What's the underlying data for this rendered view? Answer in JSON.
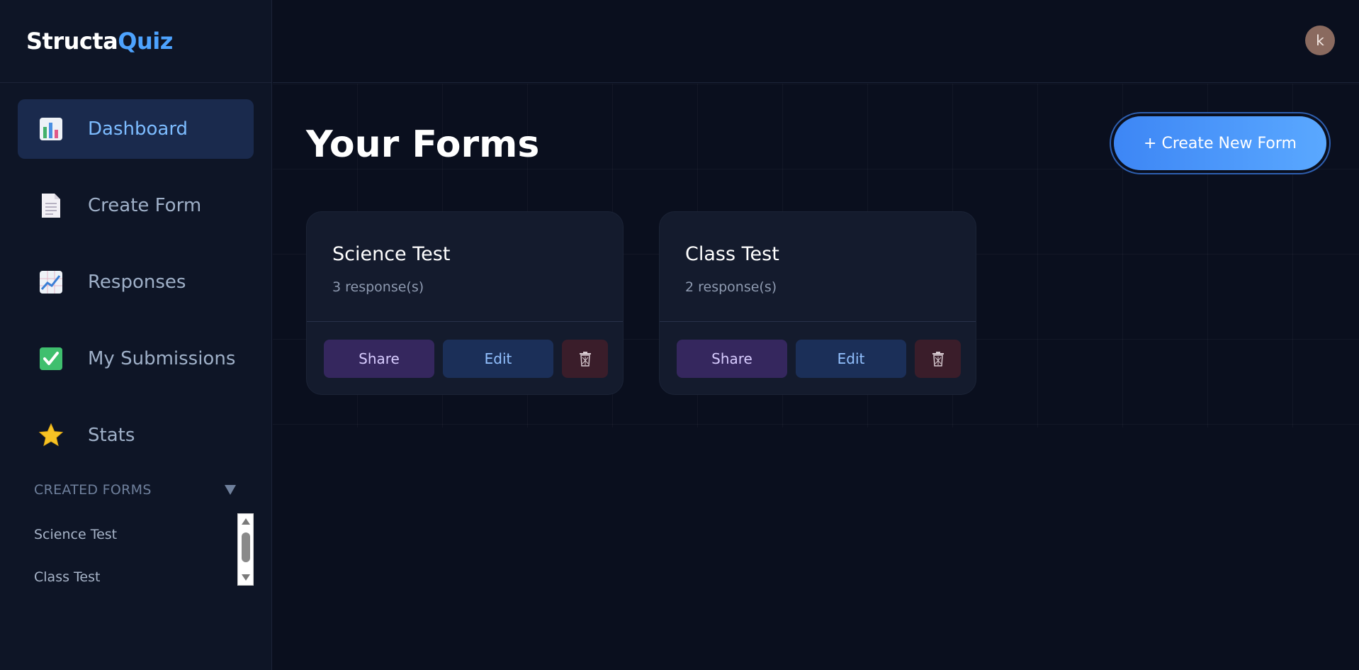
{
  "brand": {
    "part1": "Structa",
    "part2": "Quiz"
  },
  "nav": [
    {
      "label": "Dashboard",
      "icon": "bar-chart-icon",
      "active": true
    },
    {
      "label": "Create Form",
      "icon": "document-icon",
      "active": false
    },
    {
      "label": "Responses",
      "icon": "line-chart-icon",
      "active": false
    },
    {
      "label": "My Submissions",
      "icon": "checkbox-icon",
      "active": false
    },
    {
      "label": "Stats",
      "icon": "star-icon",
      "active": false
    }
  ],
  "created_forms": {
    "heading": "CREATED FORMS",
    "items": [
      "Science Test",
      "Class Test"
    ]
  },
  "user": {
    "avatar_letter": "k"
  },
  "main": {
    "title": "Your Forms",
    "create_button": "+ Create New Form",
    "forms": [
      {
        "title": "Science Test",
        "responses": "3 response(s)",
        "share": "Share",
        "edit": "Edit"
      },
      {
        "title": "Class Test",
        "responses": "2 response(s)",
        "share": "Share",
        "edit": "Edit"
      }
    ]
  },
  "colors": {
    "background": "#0a0f1e",
    "sidebar": "#0e1526",
    "accent": "#4da3ff",
    "active_nav": "#1a2a4d"
  }
}
